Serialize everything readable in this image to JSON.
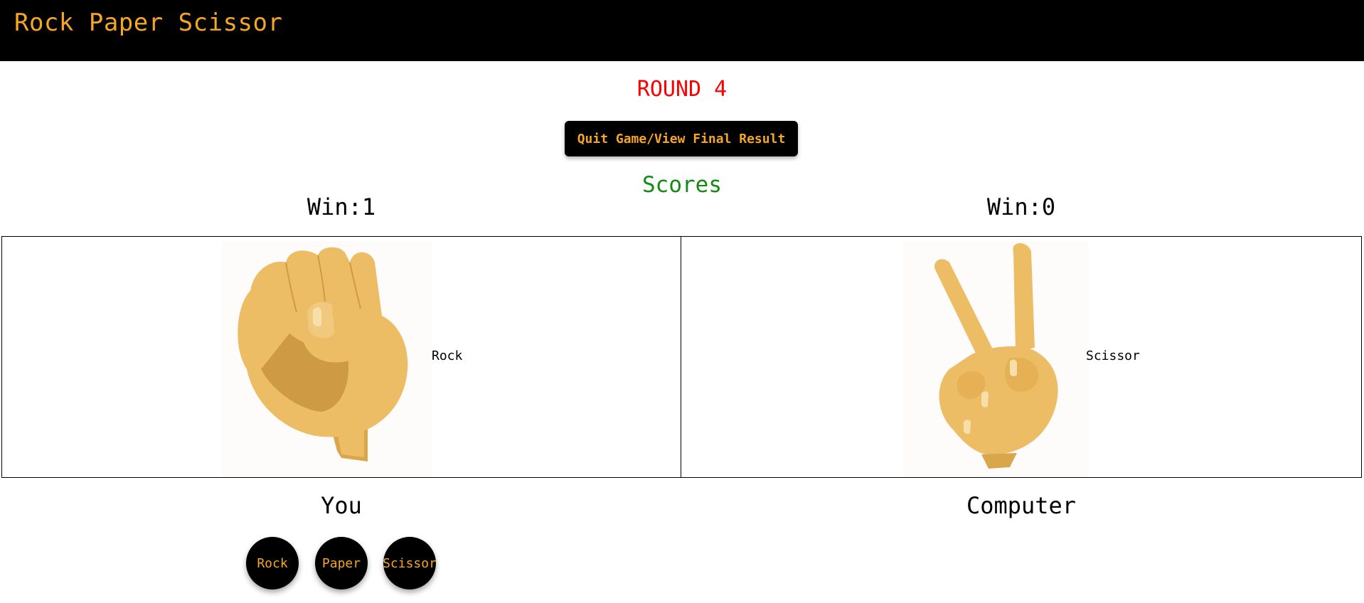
{
  "header": {
    "title": "Rock Paper Scissor"
  },
  "round": {
    "label": "ROUND",
    "number": "4"
  },
  "quit_button": "Quit Game/View Final Result",
  "scores_label": "Scores",
  "player": {
    "win_text": "Win:1",
    "name": "You",
    "choice": "Rock",
    "icon": "fist-hand-icon"
  },
  "computer": {
    "win_text": "Win:0",
    "name": "Computer",
    "choice": "Scissor",
    "icon": "victory-hand-icon"
  },
  "choice_buttons": [
    {
      "label": "Rock"
    },
    {
      "label": "Paper"
    },
    {
      "label": "Scissor"
    }
  ],
  "colors": {
    "accent": "#f5a623",
    "round": "#ff0000",
    "scores": "#138a13",
    "skin": "#edbd66"
  }
}
